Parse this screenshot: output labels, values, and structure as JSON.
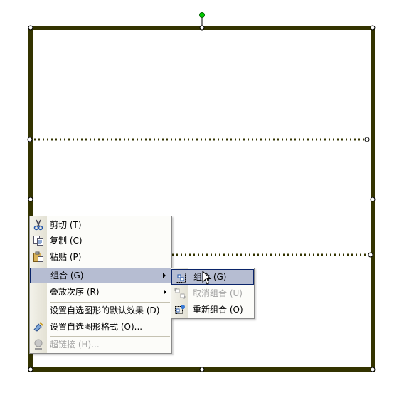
{
  "context_menu": {
    "items": [
      {
        "label": "剪切 (T)",
        "icon": "scissors-icon",
        "enabled": true,
        "submenu": false
      },
      {
        "label": "复制 (C)",
        "icon": "copy-icon",
        "enabled": true,
        "submenu": false
      },
      {
        "label": "粘贴 (P)",
        "icon": "paste-icon",
        "enabled": true,
        "submenu": false
      },
      {
        "label": "组合 (G)",
        "icon": "",
        "enabled": true,
        "submenu": true,
        "highlighted": true
      },
      {
        "label": "叠放次序 (R)",
        "icon": "",
        "enabled": true,
        "submenu": true
      },
      {
        "label": "设置自选图形的默认效果 (D)",
        "icon": "",
        "enabled": true,
        "submenu": false
      },
      {
        "label": "设置自选图形格式 (O)...",
        "icon": "format-shape-icon",
        "enabled": true,
        "submenu": false
      },
      {
        "label": "超链接 (H)...",
        "icon": "hyperlink-icon",
        "enabled": false,
        "submenu": false
      }
    ]
  },
  "group_submenu": {
    "items": [
      {
        "label": "组合 (G)",
        "icon": "group-icon",
        "enabled": true,
        "highlighted": true
      },
      {
        "label": "取消组合 (U)",
        "icon": "ungroup-icon",
        "enabled": false
      },
      {
        "label": "重新组合 (O)",
        "icon": "regroup-icon",
        "enabled": true
      }
    ]
  },
  "colors": {
    "shape_border": "#333300",
    "dotted_line": "#333300",
    "rotation_handle": "#00cc00",
    "menu_highlight": "#b6bdd2",
    "menu_highlight_border": "#0a246a",
    "disabled_text": "#a3a3a3"
  }
}
